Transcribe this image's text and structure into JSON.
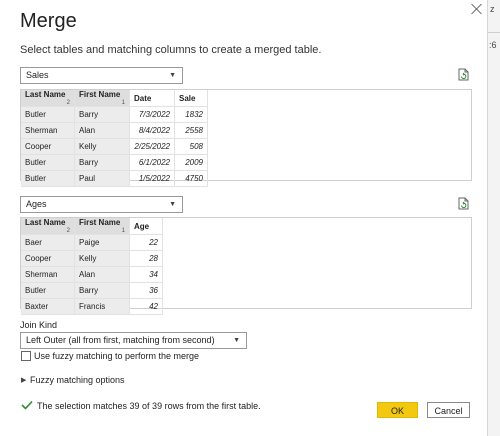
{
  "dialog": {
    "title": "Merge",
    "subtitle": "Select tables and matching columns to create a merged table."
  },
  "background_fragment": {
    "top": "z",
    "side": ":6"
  },
  "table1": {
    "selected": "Sales",
    "columns": [
      {
        "label": "Last Name",
        "sort": "2",
        "key": true
      },
      {
        "label": "First Name",
        "sort": "1",
        "key": true
      },
      {
        "label": "Date",
        "sort": "",
        "key": false
      },
      {
        "label": "Sale",
        "sort": "",
        "key": false
      }
    ],
    "rows": [
      [
        "Butler",
        "Barry",
        "7/3/2022",
        "1832"
      ],
      [
        "Sherman",
        "Alan",
        "8/4/2022",
        "2558"
      ],
      [
        "Cooper",
        "Kelly",
        "2/25/2022",
        "508"
      ],
      [
        "Butler",
        "Barry",
        "6/1/2022",
        "2009"
      ],
      [
        "Butler",
        "Paul",
        "1/5/2022",
        "4750"
      ]
    ]
  },
  "table2": {
    "selected": "Ages",
    "columns": [
      {
        "label": "Last Name",
        "sort": "2",
        "key": true
      },
      {
        "label": "First Name",
        "sort": "1",
        "key": true
      },
      {
        "label": "Age",
        "sort": "",
        "key": false
      }
    ],
    "rows": [
      [
        "Baer",
        "Paige",
        "22"
      ],
      [
        "Cooper",
        "Kelly",
        "28"
      ],
      [
        "Sherman",
        "Alan",
        "34"
      ],
      [
        "Butler",
        "Barry",
        "36"
      ],
      [
        "Baxter",
        "Francis",
        "42"
      ]
    ]
  },
  "join": {
    "label": "Join Kind",
    "selected": "Left Outer (all from first, matching from second)"
  },
  "fuzzy": {
    "checkbox_label": "Use fuzzy matching to perform the merge",
    "checked": false,
    "options_label": "Fuzzy matching options"
  },
  "status": {
    "message": "The selection matches 39 of 39 rows from the first table.",
    "color": "#2e8b2e"
  },
  "buttons": {
    "ok": "OK",
    "cancel": "Cancel"
  },
  "colors": {
    "ok_bg": "#f2c811",
    "key_col_bg": "#dedede"
  }
}
